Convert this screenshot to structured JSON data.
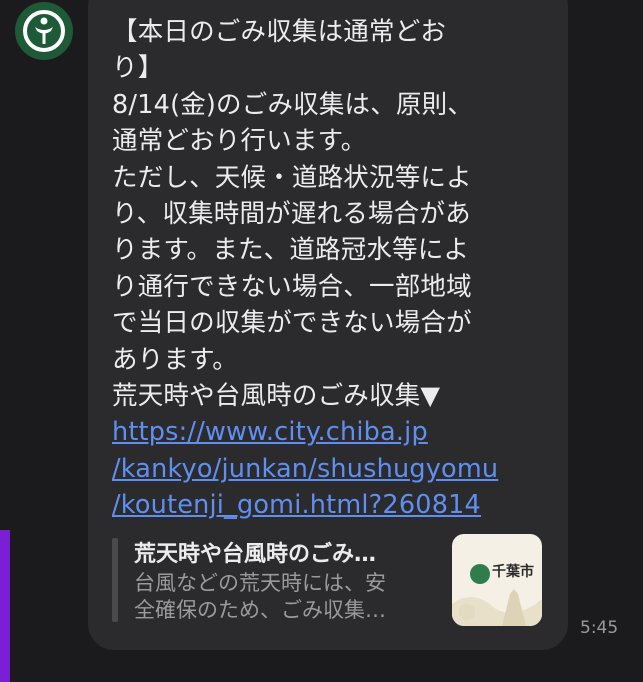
{
  "sender": {
    "avatar_icon": "chiba-city-emblem-icon",
    "avatar_color": "#1f5a38"
  },
  "message": {
    "lines": [
      "【本日のごみ収集は通常どお",
      "り】",
      "8/14(金)のごみ収集は、原則、",
      "通常どおり行います。",
      "ただし、天候・道路状況等によ",
      "り、収集時間が遅れる場合があ",
      "ります。また、道路冠水等によ",
      "り通行できない場合、一部地域",
      "で当日の収集ができない場合が",
      "あります。",
      "荒天時や台風時のごみ収集▼"
    ],
    "link_lines": [
      "https://www.city.chiba.jp",
      "/kankyo/junkan/shushugyomu",
      "/koutenji_gomi.html?260814"
    ],
    "link_color": "#5f8ff0"
  },
  "preview": {
    "title": "荒天時や台風時のごみ…",
    "desc_lines": [
      "台風などの荒天時には、安",
      "全確保のため、ごみ収集…"
    ],
    "thumb_label": "千葉市"
  },
  "timestamp": "5:45"
}
